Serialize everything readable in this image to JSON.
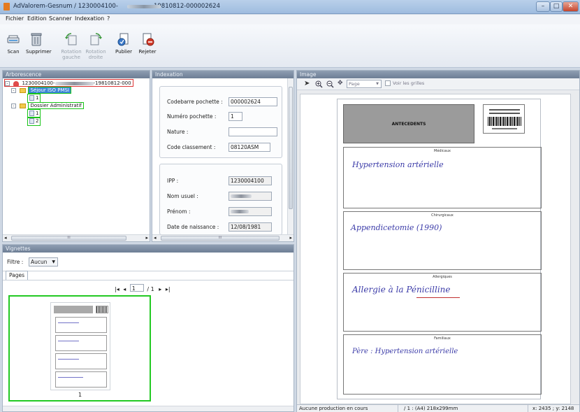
{
  "window": {
    "title": "AdValorem-Gesnum / 1230004100-",
    "title_suffix": "-19810812-000002624",
    "buttons": [
      "–",
      "□",
      "✕"
    ]
  },
  "menu": [
    "Fichier",
    "Edition",
    "Scanner",
    "Indexation",
    "?"
  ],
  "toolbar": {
    "scan": "Scan",
    "supprimer": "Supprimer",
    "rotation_gauche": "Rotation\ngauche",
    "rotation_droite": "Rotation\ndroite",
    "publier": "Publier",
    "rejeter": "Rejeter"
  },
  "arborescence": {
    "title": "Arborescence",
    "root_label": "1230004100-",
    "root_suffix": "-19810812-000",
    "folder1": "Séjour ISO PMSI",
    "folder1_pages": [
      "1"
    ],
    "folder2": "Dossier Administratif",
    "folder2_pages": [
      "1",
      "2"
    ],
    "scroll_mark": "III"
  },
  "indexation": {
    "title": "Indexation",
    "fields1": [
      {
        "label": "Codebarre pochette :",
        "value": "000002624"
      },
      {
        "label": "Numéro pochette :",
        "value": "1"
      },
      {
        "label": "Nature :",
        "value": ""
      },
      {
        "label": "Code classement :",
        "value": "08120ASM"
      }
    ],
    "fields2": [
      {
        "label": "IPP :",
        "value": "1230004100"
      },
      {
        "label": "Nom usuel :",
        "value": ""
      },
      {
        "label": "Prénom :",
        "value": ""
      },
      {
        "label": "Date de naissance :",
        "value": "12/08/1981"
      }
    ],
    "scroll_mark": "III"
  },
  "vignettes": {
    "title": "Vignettes",
    "filter_label": "Filtre :",
    "filter_value": "Aucun",
    "tab": "Pages",
    "page_nav": "1",
    "page_total": "/ 1",
    "thumb_label": "1"
  },
  "image": {
    "title": "Image",
    "zoom_mode": "Page",
    "grid_checkbox": "Voir les grilles",
    "document": {
      "header": "ANTECEDENTS",
      "sections": [
        {
          "caption": "Médicaux",
          "handwriting": "Hypertension artérielle"
        },
        {
          "caption": "Chirurgicaux",
          "handwriting": "Appendicetomie (1990)"
        },
        {
          "caption": "Allergiques",
          "handwriting": "Allergie à la Pénicilline"
        },
        {
          "caption": "Familiaux",
          "handwriting": "Père : Hypertension artérielle"
        }
      ]
    }
  },
  "status": {
    "left": "Aucune production en cours",
    "middle": "/ 1 : (A4) 218x299mm",
    "right": "x: 2435 ; y: 2148"
  }
}
